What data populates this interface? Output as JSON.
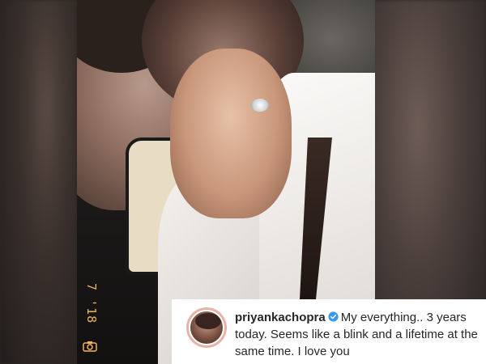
{
  "photo": {
    "timestamp_stamp": "7 '18"
  },
  "post": {
    "username": "priyankachopra",
    "verified": true,
    "caption": "My everything.. 3 years today. Seems like a blink and a lifetime at the same time. I love you"
  },
  "icons": {
    "verified": "verified-badge-icon",
    "camera": "camera-icon"
  },
  "colors": {
    "verified_blue": "#3897f0",
    "stamp_orange": "#f0b45a",
    "avatar_ring": "#e7b3a6"
  }
}
